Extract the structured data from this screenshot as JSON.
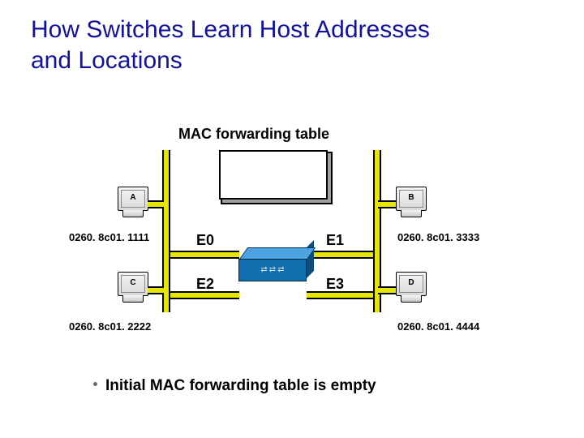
{
  "title_line1": "How Switches Learn Host Addresses",
  "title_line2": "and Locations",
  "caption": "MAC forwarding  table",
  "bullet": "Initial MAC forwarding table is empty",
  "ports": {
    "e0": "E0",
    "e1": "E1",
    "e2": "E2",
    "e3": "E3"
  },
  "hosts": {
    "A": {
      "label": "A",
      "mac": "0260. 8c01. 1111"
    },
    "B": {
      "label": "B",
      "mac": "0260. 8c01. 3333"
    },
    "C": {
      "label": "C",
      "mac": "0260. 8c01. 2222"
    },
    "D": {
      "label": "D",
      "mac": "0260. 8c01. 4444"
    }
  }
}
